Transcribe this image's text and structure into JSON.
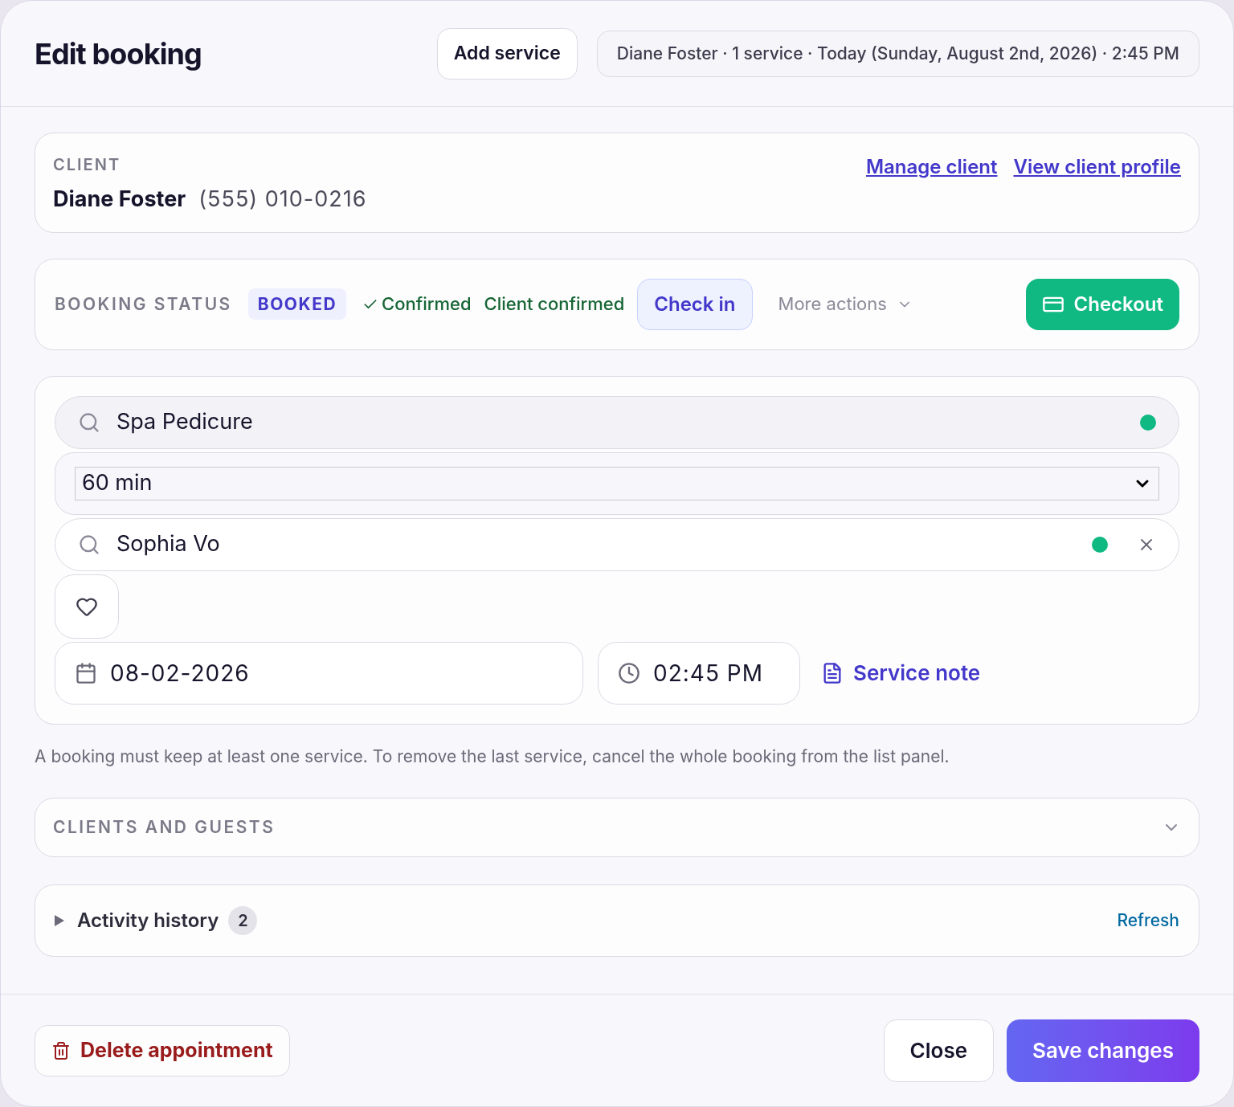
{
  "dialog": {
    "title": "Edit booking",
    "add_service": "Add service",
    "summary": "Diane Foster · 1 service · Today (Sunday, August 2nd, 2026) · 2:45 PM"
  },
  "client": {
    "heading": "CLIENT",
    "name": "Diane Foster",
    "phone": "(555) 010-0216",
    "links": [
      "Manage client",
      "View client profile"
    ]
  },
  "status": {
    "heading": "BOOKING STATUS",
    "badge": "BOOKED",
    "confirmed": "Confirmed",
    "client_confirmed": "Client confirmed",
    "check_in": "Check in",
    "more_actions": "More actions",
    "checkout": "Checkout"
  },
  "service": {
    "search": {
      "value": "Spa Pedicure",
      "color": "#10b981"
    },
    "duration": "60 min",
    "staff": {
      "value": "Sophia Vo",
      "color": "#10b981"
    },
    "favorite": false,
    "date": "08-02-2026",
    "time": "02:45 PM",
    "note": "Service note"
  },
  "hint": "A booking must keep at least one service. To remove the last service, cancel the whole booking from the list panel.",
  "guests": {
    "heading": "CLIENTS AND GUESTS",
    "expanded": false
  },
  "activity": {
    "label": "Activity history",
    "count": "2",
    "expanded": false,
    "refresh": "Refresh"
  },
  "footer": {
    "delete": "Delete appointment",
    "close": "Close",
    "save": "Save changes"
  }
}
